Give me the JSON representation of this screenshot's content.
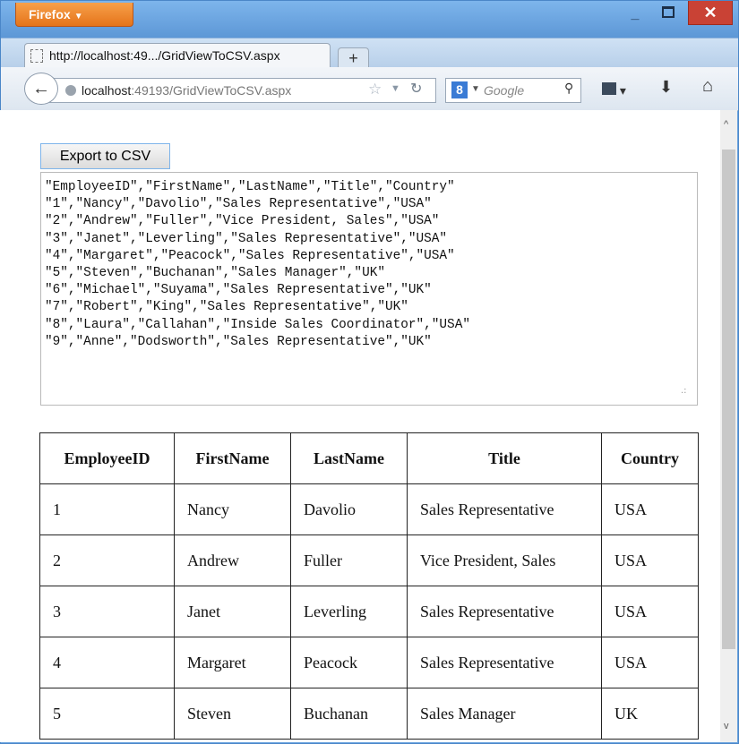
{
  "browser": {
    "app_button": "Firefox",
    "tab_title": "http://localhost:49.../GridViewToCSV.aspx",
    "new_tab": "+",
    "url_host": "localhost",
    "url_rest": ":49193/GridViewToCSV.aspx",
    "search_placeholder": "Google",
    "window_controls": {
      "minimize": "_",
      "close": "✕"
    }
  },
  "page": {
    "export_button": "Export to CSV",
    "csv_text": "\"EmployeeID\",\"FirstName\",\"LastName\",\"Title\",\"Country\"\n\"1\",\"Nancy\",\"Davolio\",\"Sales Representative\",\"USA\"\n\"2\",\"Andrew\",\"Fuller\",\"Vice President, Sales\",\"USA\"\n\"3\",\"Janet\",\"Leverling\",\"Sales Representative\",\"USA\"\n\"4\",\"Margaret\",\"Peacock\",\"Sales Representative\",\"USA\"\n\"5\",\"Steven\",\"Buchanan\",\"Sales Manager\",\"UK\"\n\"6\",\"Michael\",\"Suyama\",\"Sales Representative\",\"UK\"\n\"7\",\"Robert\",\"King\",\"Sales Representative\",\"UK\"\n\"8\",\"Laura\",\"Callahan\",\"Inside Sales Coordinator\",\"USA\"\n\"9\",\"Anne\",\"Dodsworth\",\"Sales Representative\",\"UK\"",
    "grid": {
      "headers": [
        "EmployeeID",
        "FirstName",
        "LastName",
        "Title",
        "Country"
      ],
      "rows": [
        [
          "1",
          "Nancy",
          "Davolio",
          "Sales Representative",
          "USA"
        ],
        [
          "2",
          "Andrew",
          "Fuller",
          "Vice President, Sales",
          "USA"
        ],
        [
          "3",
          "Janet",
          "Leverling",
          "Sales Representative",
          "USA"
        ],
        [
          "4",
          "Margaret",
          "Peacock",
          "Sales Representative",
          "USA"
        ],
        [
          "5",
          "Steven",
          "Buchanan",
          "Sales Manager",
          "UK"
        ]
      ]
    }
  },
  "colors": {
    "accent": "#e5741a",
    "titlebar": "#6aa3de",
    "close": "#c94235"
  }
}
